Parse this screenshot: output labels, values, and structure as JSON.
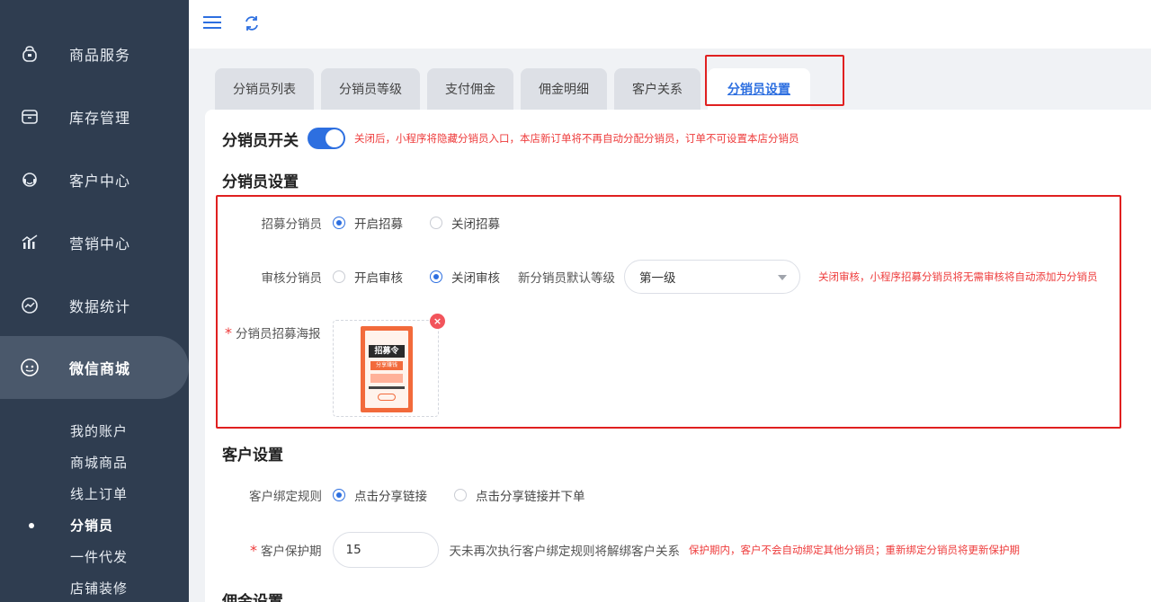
{
  "sidebar": {
    "items": [
      {
        "label": "商品服务",
        "icon": "bag-icon"
      },
      {
        "label": "库存管理",
        "icon": "archive-icon"
      },
      {
        "label": "客户中心",
        "icon": "headset-icon"
      },
      {
        "label": "营销中心",
        "icon": "chart-bars-icon"
      },
      {
        "label": "数据统计",
        "icon": "trend-circle-icon"
      },
      {
        "label": "微信商城",
        "icon": "wechat-icon"
      }
    ],
    "sub_items": [
      {
        "label": "我的账户"
      },
      {
        "label": "商城商品"
      },
      {
        "label": "线上订单"
      },
      {
        "label": "分销员"
      },
      {
        "label": "一件代发"
      },
      {
        "label": "店铺装修"
      }
    ]
  },
  "tabs": [
    {
      "label": "分销员列表"
    },
    {
      "label": "分销员等级"
    },
    {
      "label": "支付佣金"
    },
    {
      "label": "佣金明细"
    },
    {
      "label": "客户关系"
    },
    {
      "label": "分销员设置"
    }
  ],
  "switch_section": {
    "title": "分销员开关",
    "hint": "关闭后，小程序将隐藏分销员入口，本店新订单将不再自动分配分销员，订单不可设置本店分销员"
  },
  "distributor_settings": {
    "title": "分销员设置",
    "recruit": {
      "label": "招募分销员",
      "option_on": "开启招募",
      "option_off": "关闭招募"
    },
    "audit": {
      "label": "审核分销员",
      "option_on": "开启审核",
      "option_off": "关闭审核",
      "default_level_label": "新分销员默认等级",
      "default_level_value": "第一级",
      "hint": "关闭审核，小程序招募分销员将无需审核将自动添加为分销员"
    },
    "poster": {
      "required_mark": "*",
      "label": "分销员招募海报",
      "poster_title": "招募令",
      "poster_sub": "分享赚钱"
    }
  },
  "customer_settings": {
    "title": "客户设置",
    "binding_rule": {
      "label": "客户绑定规则",
      "option_a": "点击分享链接",
      "option_b": "点击分享链接并下单"
    },
    "protection": {
      "required_mark": "*",
      "label": "客户保护期",
      "value": "15",
      "suffix": "天未再次执行客户绑定规则将解绑客户关系",
      "hint": "保护期内，客户不会自动绑定其他分销员；重新绑定分销员将更新保护期"
    }
  },
  "commission_settings": {
    "title": "佣金设置"
  },
  "colors": {
    "sidebar_bg": "#2f3d50",
    "accent": "#2d6fe0",
    "hint_red": "#ee3b3b",
    "highlight_red": "#e02020"
  }
}
